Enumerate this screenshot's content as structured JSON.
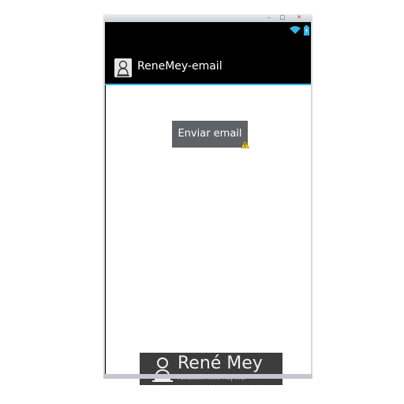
{
  "window": {
    "minimize_glyph": "–",
    "maximize_glyph": "□",
    "close_glyph": "✕"
  },
  "status_bar": {
    "icons": [
      "wifi-icon",
      "battery-charging-icon"
    ],
    "accent_color": "#33b5e5"
  },
  "action_bar": {
    "title": "ReneMey-email",
    "icon": "rene-mey-logo-icon"
  },
  "main": {
    "send_email_button": "Enviar email",
    "warning_icon": "warning-icon"
  },
  "banner": {
    "name": "René Mey",
    "subtitle": "Fundación René Mey A.C."
  },
  "colors": {
    "action_bar_bg": "#000000",
    "accent": "#33b5e5",
    "button_bg": "#5f6266",
    "button_text": "#ffffff"
  }
}
